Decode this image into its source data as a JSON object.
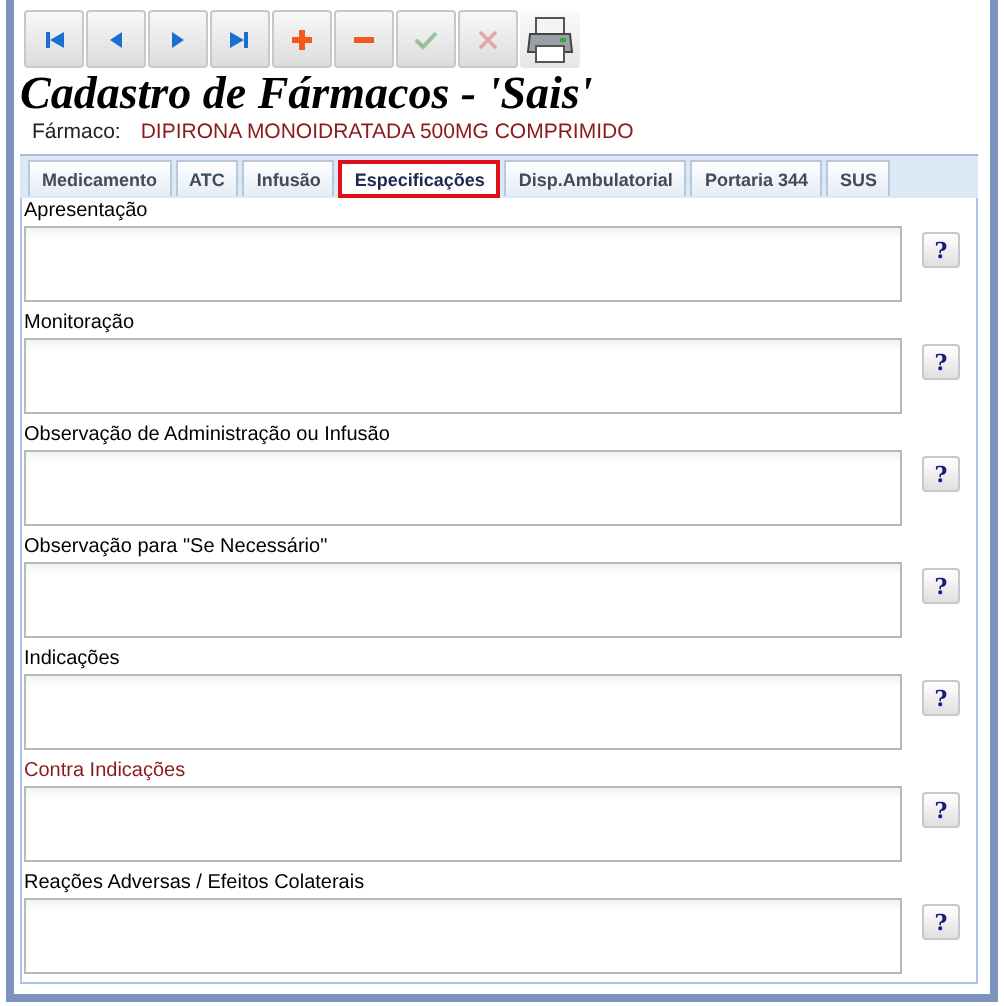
{
  "toolbar": [
    {
      "kind": "first",
      "disabled": false
    },
    {
      "kind": "prev",
      "disabled": false
    },
    {
      "kind": "next",
      "disabled": false
    },
    {
      "kind": "last",
      "disabled": false
    },
    {
      "kind": "add",
      "disabled": false
    },
    {
      "kind": "remove",
      "disabled": false
    },
    {
      "kind": "confirm",
      "disabled": true
    },
    {
      "kind": "cancel",
      "disabled": true
    },
    {
      "kind": "print",
      "disabled": false
    }
  ],
  "title": "Cadastro de Fármacos - 'Sais'",
  "drug": {
    "label": "Fármaco:",
    "value": "DIPIRONA MONOIDRATADA 500MG COMPRIMIDO"
  },
  "tabs": [
    {
      "label": "Medicamento",
      "selected": false
    },
    {
      "label": "ATC",
      "selected": false
    },
    {
      "label": "Infusão",
      "selected": false
    },
    {
      "label": "Especificações",
      "selected": true
    },
    {
      "label": "Disp.Ambulatorial",
      "selected": false
    },
    {
      "label": "Portaria 344",
      "selected": false
    },
    {
      "label": "SUS",
      "selected": false
    }
  ],
  "fields": [
    {
      "label": "Apresentação",
      "color": "#000000",
      "help": "?"
    },
    {
      "label": "Monitoração",
      "color": "#000000",
      "help": "?"
    },
    {
      "label": "Observação de Administração ou Infusão",
      "color": "#000000",
      "help": "?"
    },
    {
      "label": "Observação para \"Se Necessário\"",
      "color": "#000000",
      "help": "?"
    },
    {
      "label": "Indicações",
      "color": "#000000",
      "help": "?"
    },
    {
      "label": "Contra Indicações",
      "color": "#8b1a1a",
      "help": "?"
    },
    {
      "label": "Reações Adversas / Efeitos Colaterais",
      "color": "#000000",
      "help": "?"
    }
  ]
}
